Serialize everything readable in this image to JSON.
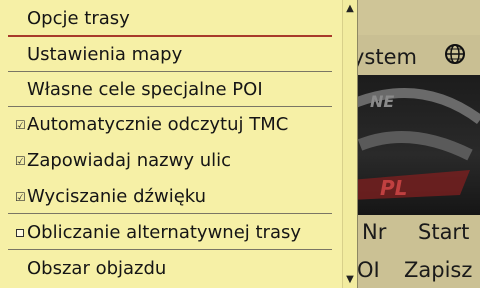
{
  "background": {
    "top_right_label": "ystem",
    "watermark_text": "NE",
    "watermark_sub": "PL",
    "nr_label": "Nr",
    "start_label": "Start",
    "oi_label": "OI",
    "zapisz_label": "Zapisz",
    "globe_icon": "globe-icon"
  },
  "menu": {
    "items": [
      {
        "label": "Opcje trasy"
      },
      {
        "label": "Ustawienia mapy"
      },
      {
        "label": "Własne cele specjalne POI"
      },
      {
        "label": "Automatycznie odczytuj TMC",
        "checked": true
      },
      {
        "label": "Zapowiadaj nazwy ulic",
        "checked": true
      },
      {
        "label": "Wyciszanie dźwięku",
        "checked": true
      },
      {
        "label": "Obliczanie alternatywnej trasy",
        "checked": false
      },
      {
        "label": "Obszar objazdu"
      }
    ],
    "check_glyph": "☑",
    "scroll_up_glyph": "▲",
    "scroll_down_glyph": "▼"
  },
  "colors": {
    "menu_bg": "#f6f0a6",
    "separator_red": "#a83a2a",
    "separator_gray": "#7a7664",
    "background_tan": "#cbc194"
  }
}
